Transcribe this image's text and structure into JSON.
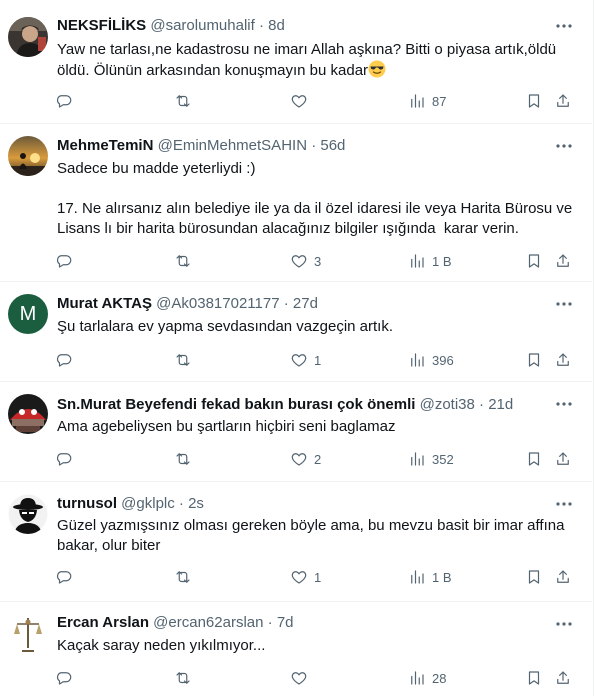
{
  "tweets": [
    {
      "name": "NEKSFİLİKS",
      "handle": "@sarolumuhalif",
      "time": "8d",
      "text": "Yaw ne tarlası,ne kadastrosu ne imarı Allah aşkına? Bitti o piyasa artık,öldü\nöldü. Ölünün arkasından konuşmayın bu kadar",
      "emoji": "sunglasses-emoji",
      "replies": "",
      "retweets": "",
      "likes": "",
      "views": "87"
    },
    {
      "name": "MehmeTemiN",
      "handle": "@EminMehmetSAHIN",
      "time": "56d",
      "text": "Sadece bu madde yeterliydi :)\n\n17. Ne alırsanız alın belediye ile ya da il özel idaresi ile veya Harita Bürosu ve\nLisans lı bir harita bürosundan alacağınız bilgiler ışığında  karar verin.",
      "replies": "",
      "retweets": "",
      "likes": "3",
      "views": "1 B"
    },
    {
      "name": "Murat AKTAŞ",
      "handle": "@Ak03817021177",
      "time": "27d",
      "avatar_letter": "M",
      "text": "Şu tarlalara ev yapma sevdasından vazgeçin artık.",
      "replies": "",
      "retweets": "",
      "likes": "1",
      "views": "396"
    },
    {
      "name": "Sn.Murat Beyefendi fekad bakın burası çok önemli",
      "handle": "@zoti38",
      "time": "21d",
      "text": "Ama agebeliysen bu şartların hiçbiri seni baglamaz",
      "replies": "",
      "retweets": "",
      "likes": "2",
      "views": "352"
    },
    {
      "name": "turnusol",
      "handle": "@gklplc",
      "time": "2s",
      "text": "Güzel yazmışsınız olması gereken böyle ama, bu mevzu basit bir imar affına\nbakar, olur biter",
      "replies": "",
      "retweets": "",
      "likes": "1",
      "views": "1 B"
    },
    {
      "name": "Ercan Arslan",
      "handle": "@ercan62arslan",
      "time": "7d",
      "text": "Kaçak saray neden yıkılmıyor...",
      "replies": "",
      "retweets": "",
      "likes": "",
      "views": "28"
    }
  ],
  "separator": "·",
  "icons": {
    "more": "more-icon",
    "reply": "reply-icon",
    "retweet": "retweet-icon",
    "like": "like-icon",
    "views": "views-icon",
    "bookmark": "bookmark-icon",
    "share": "share-icon"
  },
  "colors": {
    "text": "#0f1419",
    "secondary": "#536471",
    "border": "#eff3f4",
    "avatar_m": "#1b5e3f"
  }
}
